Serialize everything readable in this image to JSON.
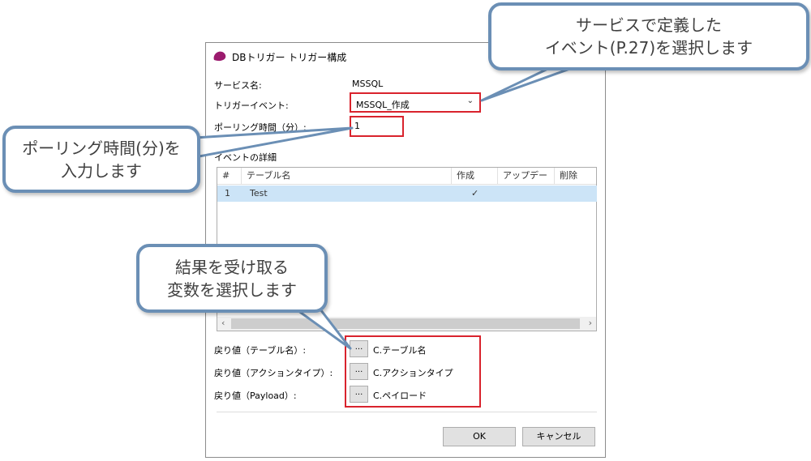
{
  "dialog": {
    "title": "DBトリガー トリガー構成",
    "service_label": "サービス名:",
    "service_value": "MSSQL",
    "trigger_event_label": "トリガーイベント:",
    "trigger_event_value": "MSSQL_作成",
    "polling_label": "ポーリング時間（分）:",
    "polling_value": "1",
    "event_details_label": "イベントの詳細",
    "table": {
      "columns": [
        "#",
        "テーブル名",
        "作成",
        "アップデート",
        "削除"
      ],
      "rows": [
        {
          "num": "1",
          "name": "Test",
          "create": "✓",
          "update": "",
          "delete": ""
        }
      ]
    },
    "return_values": [
      {
        "label": "戻り値（テーブル名）:",
        "button": "...",
        "value": "C.テーブル名"
      },
      {
        "label": "戻り値（アクションタイプ）:",
        "button": "...",
        "value": "C.アクションタイプ"
      },
      {
        "label": "戻り値（Payload）:",
        "button": "...",
        "value": "C.ペイロード"
      }
    ],
    "ok_label": "OK",
    "cancel_label": "キャンセル"
  },
  "callouts": {
    "top_right": {
      "line1": "サービスで定義した",
      "line2": "イベント(P.27)を選択します"
    },
    "left": {
      "line1": "ポーリング時間(分)を",
      "line2": "入力します"
    },
    "bottom": {
      "line1": "結果を受け取る",
      "line2": "変数を選択します"
    }
  },
  "colors": {
    "highlight": "#d9232d",
    "callout_border": "#6b8fb5",
    "selected_row": "#cce4f7",
    "app_icon": "#9b1b6e"
  }
}
